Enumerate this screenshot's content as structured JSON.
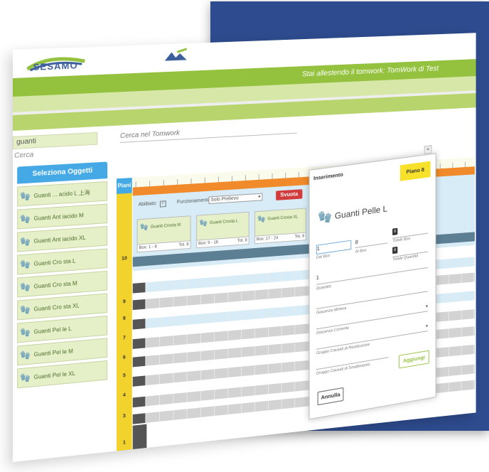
{
  "app": {
    "logo_text": "SESAMO",
    "banner": "Stai allestendo il tomwork: TomWork di Test"
  },
  "search": {
    "value": "guanti",
    "cerca_label": "Cerca",
    "tomwork_placeholder": "Cerca nel Tomwork"
  },
  "sidebar": {
    "header": "Seleziona Oggetti",
    "items": [
      {
        "label": "Guanti ... acido L 上海",
        "icon": "glove-blue-icon"
      },
      {
        "label": "Guanti Ant iacido M",
        "icon": "glove-blue-icon"
      },
      {
        "label": "Guanti Ant iacido XL",
        "icon": "glove-blue-icon"
      },
      {
        "label": "Guanti Cro sta L",
        "icon": "glove-yellow-icon"
      },
      {
        "label": "Guanti Cro sta M",
        "icon": "glove-yellow-icon"
      },
      {
        "label": "Guanti Cro sta XL",
        "icon": "glove-yellow-icon"
      },
      {
        "label": "Guanti Pel le L",
        "icon": "glove-grey-icon"
      },
      {
        "label": "Guanti Pel le M",
        "icon": "glove-grey-icon"
      },
      {
        "label": "Guanti Pel le XL",
        "icon": "glove-grey-icon"
      }
    ]
  },
  "piani": {
    "header": "Piani",
    "levels": [
      "10",
      "9",
      "8",
      "7",
      "6",
      "5",
      "4",
      "3",
      "1"
    ]
  },
  "controls": {
    "abilitato": "Abilitato:",
    "funzionamento": "Funzionamento:",
    "mode": "Solo Prelievo",
    "svuota": "Svuota"
  },
  "bins": [
    {
      "name": "Guanti Crosta M",
      "box": "Box: 1 - 8",
      "tot": "Tot. 8"
    },
    {
      "name": "Guanti Crosta L",
      "box": "Box: 9 - 16",
      "tot": "Tot. 8"
    },
    {
      "name": "Guanti Crosta XL",
      "box": "Box: 17 - 24",
      "tot": "Tot. 8"
    }
  ],
  "modal": {
    "title": "Inserimento",
    "piano": "Piano 8",
    "product": "Guanti Pelle L",
    "dal_box_value": "1",
    "dal_box_label": "Dal Box",
    "al_box_value": "8",
    "al_box_label": "Al Box",
    "totale_box_value": "8",
    "totale_box_label": "Totale Box",
    "totale_quantita_value": "8",
    "totale_quantita_label": "Totale Quantità",
    "quantita_value": "1",
    "quantita_label": "Quantità",
    "giacenza_minima_label": "Giacenza Minima",
    "giacenza_corrente_label": "Giacenza Corrente",
    "gruppo_restituzione_label": "Gruppo Causali di Restituzione",
    "gruppo_smaltimento_label": "Gruppo Causali di Smaltimento",
    "aggiungi": "Aggiungi",
    "annulla": "Annulla"
  },
  "colors": {
    "green": "#94c23e",
    "blue": "#44a9e4",
    "orange": "#f18a2b",
    "yellow": "#f2d22c",
    "red": "#d23b3b",
    "slab": "#2d4b8e"
  }
}
